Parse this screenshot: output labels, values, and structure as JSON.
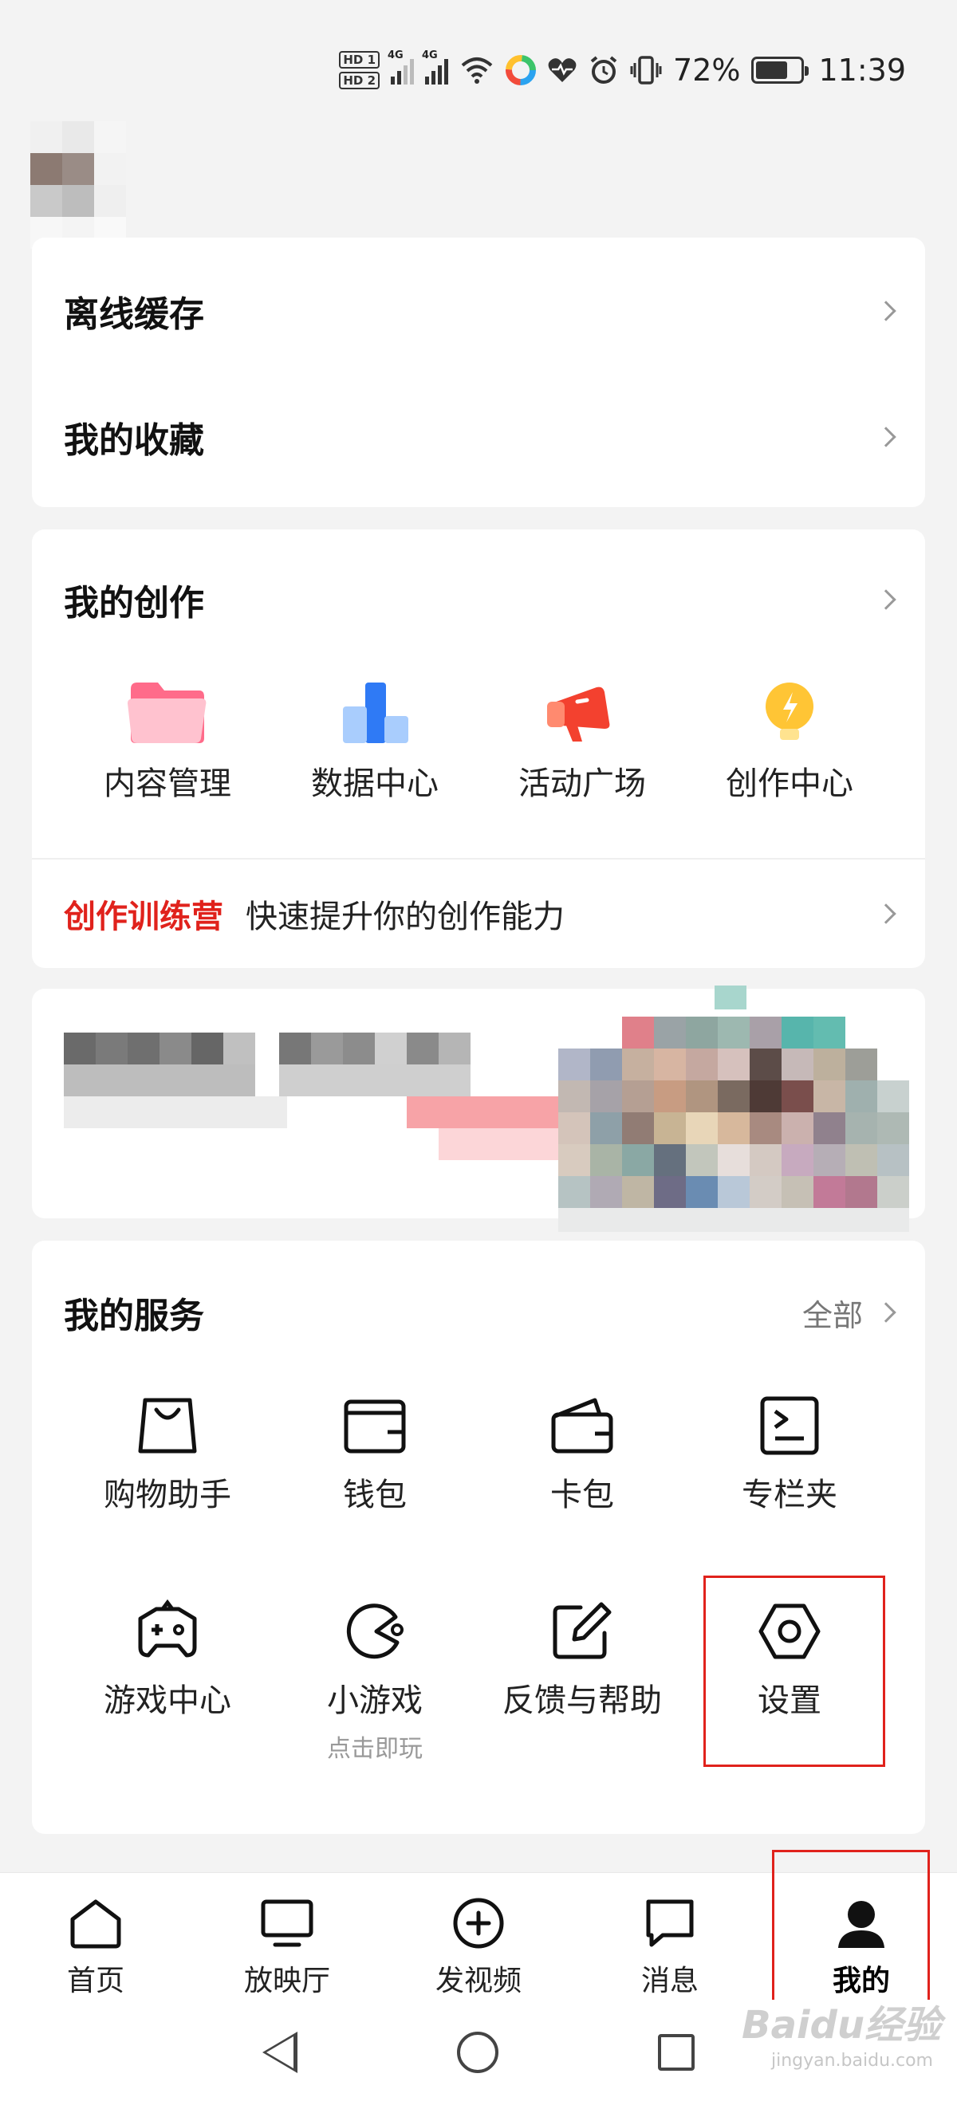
{
  "status_bar": {
    "hd1": "HD 1",
    "hd2": "HD 2",
    "net1": "4G",
    "net2": "4G",
    "battery_text": "72%",
    "battery_level": 0.72,
    "time": "11:39"
  },
  "menu_card": {
    "items": [
      {
        "label": "离线缓存"
      },
      {
        "label": "我的收藏"
      }
    ]
  },
  "creation": {
    "title": "我的创作",
    "items": [
      {
        "label": "内容管理",
        "icon": "folder-icon"
      },
      {
        "label": "数据中心",
        "icon": "bar-chart-icon"
      },
      {
        "label": "活动广场",
        "icon": "megaphone-icon"
      },
      {
        "label": "创作中心",
        "icon": "lightbulb-icon"
      }
    ],
    "camp_label": "创作训练营",
    "camp_desc": "快速提升你的创作能力"
  },
  "services": {
    "title": "我的服务",
    "all_label": "全部",
    "items": [
      {
        "label": "购物助手",
        "icon": "shopping-bag-icon"
      },
      {
        "label": "钱包",
        "icon": "wallet-icon"
      },
      {
        "label": "卡包",
        "icon": "card-wallet-icon"
      },
      {
        "label": "专栏夹",
        "icon": "column-folder-icon"
      },
      {
        "label": "游戏中心",
        "icon": "gamepad-icon"
      },
      {
        "label": "小游戏",
        "sub": "点击即玩",
        "icon": "pacman-icon"
      },
      {
        "label": "反馈与帮助",
        "icon": "edit-feedback-icon"
      },
      {
        "label": "设置",
        "icon": "settings-hexagon-icon"
      }
    ]
  },
  "bottom_nav": {
    "items": [
      {
        "label": "首页",
        "icon": "home-icon"
      },
      {
        "label": "放映厅",
        "icon": "tv-icon"
      },
      {
        "label": "发视频",
        "icon": "plus-circle-icon"
      },
      {
        "label": "消息",
        "icon": "message-icon"
      },
      {
        "label": "我的",
        "icon": "profile-icon",
        "active": true
      }
    ]
  },
  "watermark": {
    "text": "Baidu经验",
    "sub": "jingyan.baidu.com"
  },
  "colors": {
    "accent_red": "#e0221c",
    "card_bg": "#ffffff",
    "page_bg": "#f3f3f3"
  }
}
